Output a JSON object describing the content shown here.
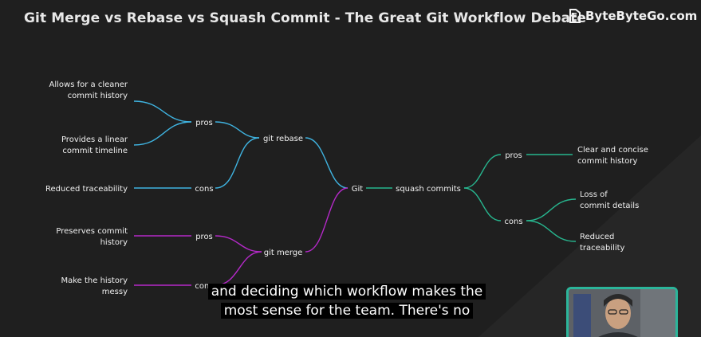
{
  "header": {
    "title": "Git Merge vs Rebase vs Squash Commit - The Great Git Workflow Debate",
    "brand": "ByteByteGo.com",
    "brand_icon": "bytebytego-logo-icon"
  },
  "colors": {
    "background": "#1f1f1f",
    "rebase_branch": "#3fb3e0",
    "merge_branch": "#b529c9",
    "squash_branch": "#27b58e",
    "text": "#f0f0f0",
    "avatar_border": "#2bb59a"
  },
  "diagram": {
    "root": "Git",
    "rebase": {
      "label": "git rebase",
      "pros_label": "pros",
      "cons_label": "cons",
      "pros": [
        [
          "Allows for a cleaner",
          "commit history"
        ],
        [
          "Provides a linear",
          "commit timeline"
        ]
      ],
      "cons": [
        [
          "Reduced traceability"
        ]
      ]
    },
    "merge": {
      "label": "git merge",
      "pros_label": "pros",
      "cons_label": "cons",
      "pros": [
        [
          "Preserves commit",
          "history"
        ]
      ],
      "cons": [
        [
          "Make the history",
          "messy"
        ]
      ]
    },
    "squash": {
      "label": "squash commits",
      "pros_label": "pros",
      "cons_label": "cons",
      "pros": [
        [
          "Clear and concise",
          "commit history"
        ]
      ],
      "cons": [
        [
          "Loss of",
          "commit details"
        ],
        [
          "Reduced",
          "traceability"
        ]
      ]
    }
  },
  "caption": {
    "line1": "and deciding which workflow makes the",
    "line2": "most sense for the team. There's no"
  },
  "presenter": {
    "video_label": "presenter-webcam"
  }
}
